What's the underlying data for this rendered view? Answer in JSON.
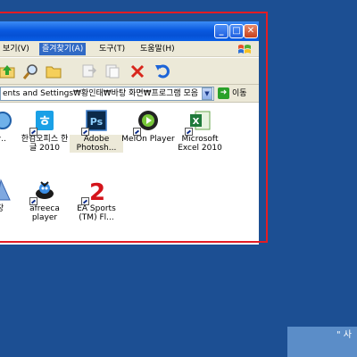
{
  "window": {
    "title": "",
    "controls": {
      "minimize": "_",
      "maximize": "□",
      "close": "✕"
    }
  },
  "menubar": {
    "items": [
      {
        "label": "보기(V)"
      },
      {
        "label": "즐겨찾기(A)"
      },
      {
        "label": "도구(T)"
      },
      {
        "label": "도움말(H)"
      }
    ]
  },
  "toolbar": {
    "icons": [
      "up-folder-icon",
      "search-icon",
      "folders-icon",
      "move-to-icon",
      "copy-to-icon",
      "delete-icon",
      "undo-icon"
    ]
  },
  "address": {
    "value": "ents and Settings₩황인태₩바탕 화면₩프로그램 모음",
    "go_label": "이동"
  },
  "files": [
    {
      "label": "라..",
      "icon": "partial-icon"
    },
    {
      "label": "한컴오피스 한글 2010",
      "icon": "hancom-icon"
    },
    {
      "label": "Adobe Photosh...",
      "icon": "photoshop-icon"
    },
    {
      "label": "MelOn Player",
      "icon": "melon-icon"
    },
    {
      "label": "Microsoft Excel 2010",
      "icon": "excel-icon"
    },
    {
      "label": "장",
      "icon": "partial-icon"
    },
    {
      "label": "afreeca player",
      "icon": "afreeca-icon"
    },
    {
      "label": "EA Sports (TM) Fl...",
      "icon": "ea-sports-icon"
    }
  ],
  "taskbar": {
    "tip_text": "\" 사"
  },
  "colors": {
    "desktop": "#1c4f93",
    "highlight": "#e51c23",
    "titlebar": "#0a5ae0",
    "menu_active": "#316ac5"
  }
}
